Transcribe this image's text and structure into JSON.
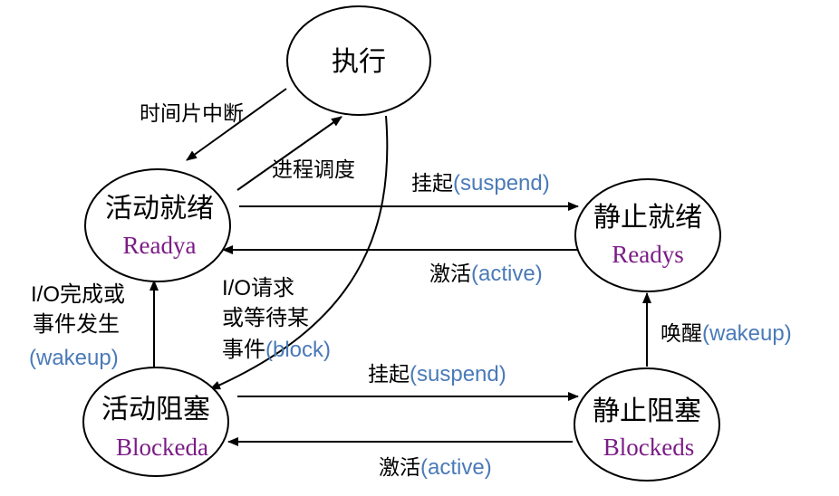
{
  "colors": {
    "state_english": "#7b1c86",
    "event_english": "#4a7ab8",
    "stroke": "#000000"
  },
  "nodes": {
    "exec": {
      "title": "执行"
    },
    "ready_active": {
      "title": "活动就绪",
      "sub": "Readya"
    },
    "ready_static": {
      "title": "静止就绪",
      "sub": "Readys"
    },
    "blocked_active": {
      "title": "活动阻塞",
      "sub": "Blockeda"
    },
    "blocked_static": {
      "title": "静止阻塞",
      "sub": "Blockeds"
    }
  },
  "edges": {
    "timeslice": {
      "cn": "时间片中断"
    },
    "schedule": {
      "cn": "进程调度"
    },
    "suspend_ready": {
      "cn": "挂起",
      "en": "(suspend)"
    },
    "activate_ready": {
      "cn": "激活",
      "en": "(active)"
    },
    "io_request": {
      "line1": "I/O请求",
      "line2": "或等待某",
      "line3_cn": "事件",
      "line3_en": "(block)"
    },
    "io_complete": {
      "line1": "I/O完成或",
      "line2": "事件发生",
      "line3_en": "(wakeup)"
    },
    "wakeup": {
      "cn": "唤醒",
      "en": "(wakeup)"
    },
    "suspend_blocked": {
      "cn": "挂起",
      "en": "(suspend)"
    },
    "activate_blocked": {
      "cn": "激活",
      "en": "(active)"
    }
  }
}
